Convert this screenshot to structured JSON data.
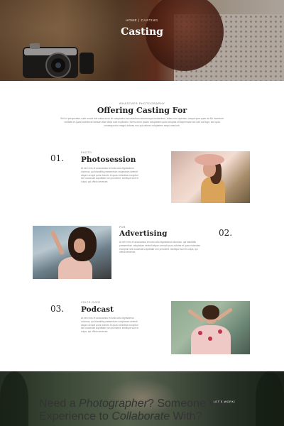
{
  "hero": {
    "breadcrumb": "Home | Casting",
    "title": "Casting"
  },
  "intro": {
    "eyebrow": "Whatever photography",
    "title": "Offering Casting For",
    "text": "Sed ut perspiciatis unde omnis iste natus error sit voluptatem accusantium doloremque laudantium, totam rem aperiam, eaque ipsa quae ab illo inventore veritatis et quasi architecto beatae vitae dicta sunt explicabo. Nemo enim ipsam voluptatem quia voluptas sit aspernatur aut odit aut fugit, sed quia consequuntur magni dolores eos qui ratione voluptatem sequi nesciunt."
  },
  "services": [
    {
      "number": "01.",
      "eyebrow": "Photo",
      "title": "Photosession",
      "text": "At vero eos et accusamus et iusto odio dignissimos ducimus, qui blanditiis praesentium voluptatum deleniti atque corrupti quos dolores et quas molestias excepturi sint occaecati cupiditate non provident, similique sunt in culpa, qui officia deserunt."
    },
    {
      "number": "02.",
      "eyebrow": "Pub",
      "title": "Advertising",
      "text": "At vero eos et accusamus et iusto odio dignissimos ducimus, qui blanditiis praesentium voluptatum deleniti atque corrupti quos dolores et quas molestias excepturi sint occaecati cupiditate non provident, similique sunt in culpa, qui officia deserunt."
    },
    {
      "number": "03.",
      "eyebrow": "Voice over",
      "title": "Podcast",
      "text": "At vero eos et accusamus et iusto odio dignissimos ducimus, qui blanditiis praesentium voluptatum deleniti atque corrupti quos dolores et quas molestias excepturi sint occaecati cupiditate non provident, similique sunt in culpa, qui officia deserunt."
    }
  ],
  "cta": {
    "part1": "Need a ",
    "highlight1": "Photographer",
    "part2": "? Someone With Experience to ",
    "highlight2": "Collaborate",
    "part3": " With?",
    "button": "Let's work!"
  },
  "colors": {
    "text_dark": "#222222",
    "text_muted": "#888888",
    "background": "#ffffff"
  }
}
